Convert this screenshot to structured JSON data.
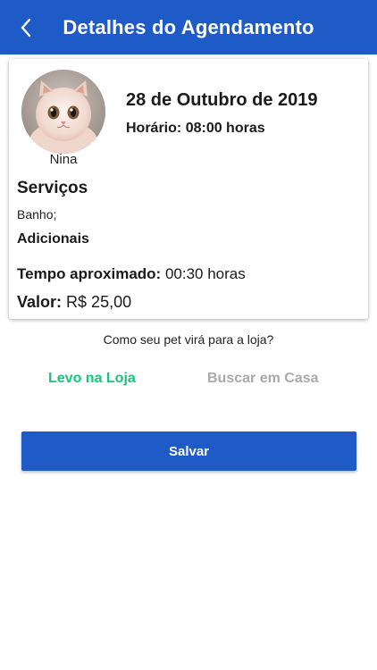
{
  "header": {
    "title": "Detalhes do Agendamento",
    "back_icon": "chevron-left-icon",
    "background_color": "#1e5bc6"
  },
  "appointment": {
    "pet_name": "Nina",
    "pet_photo": "white-persian-kitten-photo",
    "date": "28 de Outubro de 2019",
    "time_label": "Horário:",
    "time_value": "08:00 horas",
    "services_title": "Serviços",
    "services_list": "Banho;",
    "extras_title": "Adicionais",
    "duration_label": "Tempo aproximado:",
    "duration_value": "00:30 horas",
    "price_label": "Valor:",
    "price_value": "R$ 25,00"
  },
  "delivery": {
    "question": "Como seu pet virá para a loja?",
    "options": [
      {
        "label": "Levo na Loja",
        "selected": true,
        "color": "#14c77a"
      },
      {
        "label": "Buscar em Casa",
        "selected": false,
        "color": "#a9a9a9"
      }
    ]
  },
  "actions": {
    "save_label": "Salvar"
  }
}
